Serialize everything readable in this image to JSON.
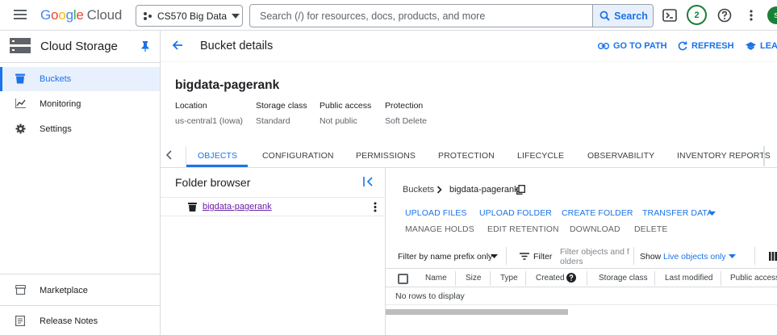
{
  "topbar": {
    "logo_word_google": [
      "G",
      "o",
      "o",
      "g",
      "l",
      "e"
    ],
    "logo_word_cloud": "Cloud",
    "project_name": "CS570 Big Data",
    "search_placeholder": "Search (/) for resources, docs, products, and more",
    "search_button": "Search",
    "notification_count": "2",
    "avatar_initial": "s"
  },
  "sidebar": {
    "title": "Cloud Storage",
    "items": [
      {
        "label": "Buckets",
        "icon": "bucket-icon",
        "active": true
      },
      {
        "label": "Monitoring",
        "icon": "monitoring-chart-icon"
      },
      {
        "label": "Settings",
        "icon": "gear-icon"
      }
    ],
    "bottom_items": [
      {
        "label": "Marketplace",
        "icon": "marketplace-icon"
      },
      {
        "label": "Release Notes",
        "icon": "release-notes-icon"
      }
    ]
  },
  "header": {
    "title": "Bucket details",
    "go_to_path": "GO TO PATH",
    "refresh": "REFRESH",
    "learn": "LEAR"
  },
  "bucket": {
    "name": "bigdata-pagerank",
    "meta": [
      {
        "label": "Location",
        "value": "us-central1 (Iowa)"
      },
      {
        "label": "Storage class",
        "value": "Standard"
      },
      {
        "label": "Public access",
        "value": "Not public"
      },
      {
        "label": "Protection",
        "value": "Soft Delete"
      }
    ]
  },
  "tabs": [
    "OBJECTS",
    "CONFIGURATION",
    "PERMISSIONS",
    "PROTECTION",
    "LIFECYCLE",
    "OBSERVABILITY",
    "INVENTORY REPORTS"
  ],
  "active_tab": "OBJECTS",
  "folder_browser": {
    "title": "Folder browser",
    "item": "bigdata-pagerank"
  },
  "objects": {
    "breadcrumb_root": "Buckets",
    "breadcrumb_current": "bigdata-pagerank",
    "actions_primary": [
      "UPLOAD FILES",
      "UPLOAD FOLDER",
      "CREATE FOLDER",
      "TRANSFER DATA"
    ],
    "actions_secondary": [
      "MANAGE HOLDS",
      "EDIT RETENTION",
      "DOWNLOAD",
      "DELETE"
    ],
    "filter_mode": "Filter by name prefix only",
    "filter_label": "Filter",
    "filter_placeholder_line1": "Filter objects and f",
    "filter_placeholder_line2": "olders",
    "show_label": "Show",
    "show_value": "Live objects only",
    "columns": [
      "Name",
      "Size",
      "Type",
      "Created",
      "Storage class",
      "Last modified",
      "Public access"
    ],
    "empty_message": "No rows to display"
  },
  "colors": {
    "accent": "#1a73e8",
    "active_bg": "#e8f0fe",
    "notif_green": "#188038",
    "visited_link": "#681da8"
  }
}
